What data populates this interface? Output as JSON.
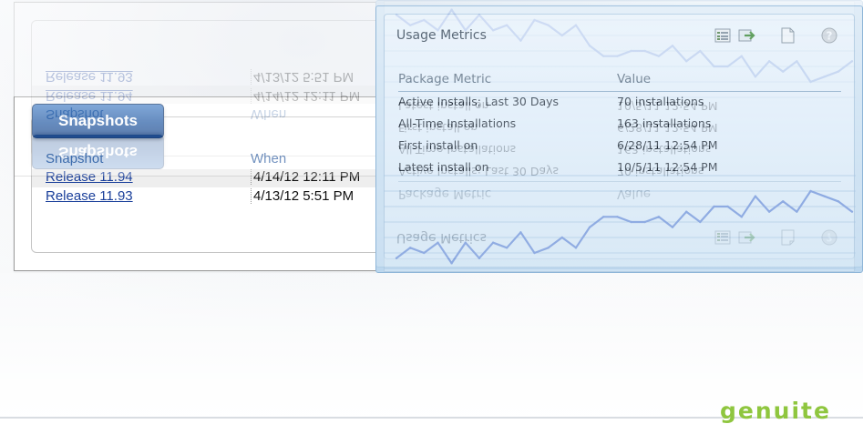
{
  "snapshots": {
    "tab_label": "Snapshots",
    "columns": [
      "Snapshot",
      "When"
    ],
    "rows": [
      {
        "name": "Release 11.94",
        "when": "4/14/12 12:11 PM"
      },
      {
        "name": "Release 11.93",
        "when": "4/13/12 5:51 PM"
      }
    ]
  },
  "metrics": {
    "title": "Usage Metrics",
    "toolbar_icons": [
      "list-view-icon",
      "export-icon",
      "document-icon",
      "help-icon"
    ],
    "columns": [
      "Package Metric",
      "Value"
    ],
    "rows": [
      {
        "metric": "Active Installs; Last 30 Days",
        "value": "70 installations"
      },
      {
        "metric": "All-Time Installations",
        "value": "163 installations"
      },
      {
        "metric": "First install on",
        "value": "6/28/11 12:54 PM"
      },
      {
        "metric": "Latest install on",
        "value": "10/5/11 12:54 PM"
      }
    ]
  },
  "chart_data": {
    "type": "line",
    "series": [
      {
        "values": [
          2,
          4,
          3,
          5,
          1,
          5,
          2,
          5,
          4,
          7,
          3,
          4,
          6,
          4,
          8,
          10,
          10,
          9,
          9,
          10,
          8,
          11,
          9,
          12,
          12,
          10,
          14,
          11,
          13,
          11,
          15,
          14,
          13,
          11
        ]
      }
    ],
    "ylim": [
      0,
      18
    ],
    "grid": true,
    "line_color": "#6a8fd8"
  },
  "logo": {
    "text": "genuite",
    "color": "#8fc63f"
  }
}
